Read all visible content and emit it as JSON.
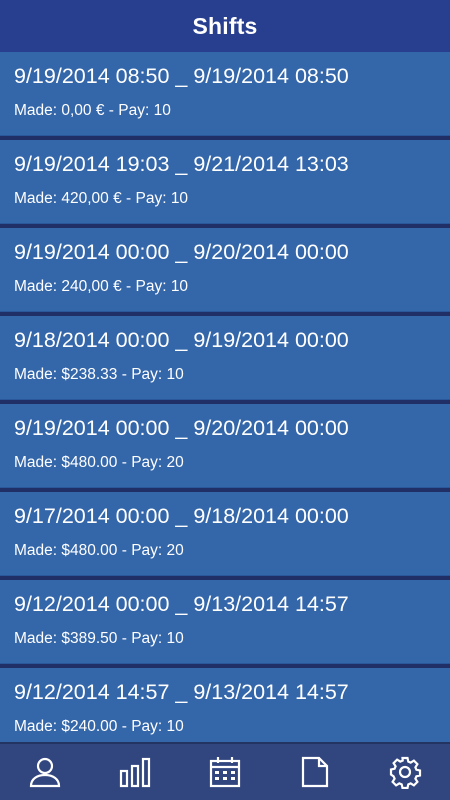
{
  "header": {
    "title": "Shifts"
  },
  "shifts": [
    {
      "time": "9/19/2014 08:50 _ 9/19/2014 08:50",
      "meta": "Made: 0,00 € - Pay: 10"
    },
    {
      "time": "9/19/2014 19:03 _ 9/21/2014 13:03",
      "meta": "Made: 420,00 € - Pay: 10"
    },
    {
      "time": "9/19/2014 00:00 _ 9/20/2014 00:00",
      "meta": "Made: 240,00 € - Pay: 10"
    },
    {
      "time": "9/18/2014 00:00 _ 9/19/2014 00:00",
      "meta": "Made: $238.33 - Pay: 10"
    },
    {
      "time": "9/19/2014 00:00 _ 9/20/2014 00:00",
      "meta": "Made: $480.00 - Pay: 20"
    },
    {
      "time": "9/17/2014 00:00 _ 9/18/2014 00:00",
      "meta": "Made: $480.00 - Pay: 20"
    },
    {
      "time": "9/12/2014 00:00 _ 9/13/2014 14:57",
      "meta": "Made: $389.50 - Pay: 10"
    },
    {
      "time": "9/12/2014 14:57 _ 9/13/2014 14:57",
      "meta": "Made: $240.00 - Pay: 10"
    }
  ],
  "bottom_nav": {
    "items": [
      {
        "icon": "user-icon"
      },
      {
        "icon": "bar-chart-icon"
      },
      {
        "icon": "calendar-icon"
      },
      {
        "icon": "document-icon"
      },
      {
        "icon": "gear-icon"
      }
    ]
  },
  "colors": {
    "header_bg": "#283f8f",
    "row_bg": "#3466aa",
    "nav_bg": "#31457f",
    "text": "#ffffff"
  }
}
